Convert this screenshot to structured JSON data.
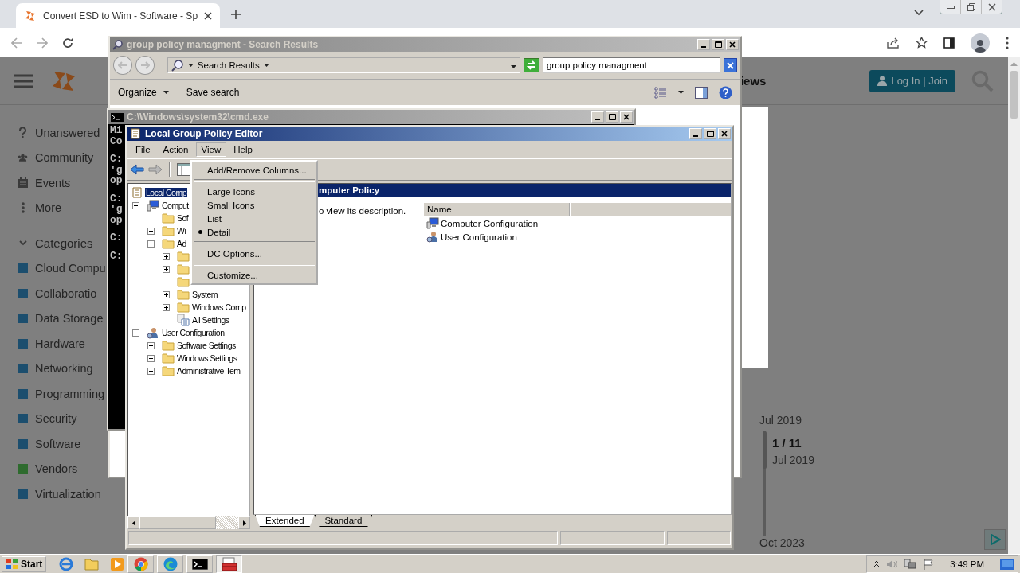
{
  "browser": {
    "tab": {
      "title": "Convert ESD to Wim - Software - Sp",
      "selected": true
    }
  },
  "website": {
    "nav_fragment": "iews",
    "login_button": "Log In | Join",
    "sidebar": [
      {
        "kind": "question",
        "label": "Unanswered"
      },
      {
        "kind": "people",
        "label": "Community"
      },
      {
        "kind": "calendar",
        "label": "Events"
      },
      {
        "kind": "dots",
        "label": "More"
      }
    ],
    "categories_heading": "Categories",
    "categories": [
      {
        "label": "Cloud Compu",
        "color": "#1c4e6e"
      },
      {
        "label": "Collaboratio",
        "color": "#1c4e6e"
      },
      {
        "label": "Data Storage",
        "color": "#1c4e6e"
      },
      {
        "label": "Hardware",
        "color": "#1c4e6e"
      },
      {
        "label": "Networking",
        "color": "#1c4e6e"
      },
      {
        "label": "Programming",
        "color": "#1c4e6e"
      },
      {
        "label": "Security",
        "color": "#1c4e6e"
      },
      {
        "label": "Software",
        "color": "#1c4e6e"
      },
      {
        "label": "Vendors",
        "color": "#2e6b2e"
      },
      {
        "label": "Virtualization",
        "color": "#1c4e6e"
      }
    ],
    "timeline": {
      "start": "Jul 2019",
      "position": "1 / 11",
      "position_date": "Jul 2019",
      "end": "Oct 2023"
    }
  },
  "search_window": {
    "title": "group policy managment - Search Results",
    "active": false,
    "address": "Search Results",
    "search_value": "group policy managment",
    "commands": [
      "Organize",
      "Save search"
    ]
  },
  "cmd_window": {
    "title": "C:\\Windows\\system32\\cmd.exe",
    "active": false,
    "blocks": [
      [
        "Mi",
        "Co"
      ],
      [
        "C:",
        "'g",
        "op"
      ],
      [
        "C:",
        "'g",
        "op"
      ],
      [
        "C:"
      ],
      [
        "C:"
      ]
    ]
  },
  "gpe_window": {
    "title": "Local Group Policy Editor",
    "active": true,
    "menu": [
      {
        "label": "File",
        "selected": false
      },
      {
        "label": "Action",
        "selected": false
      },
      {
        "label": "View",
        "selected": true
      },
      {
        "label": "Help",
        "selected": false
      }
    ],
    "view_menu": [
      {
        "kind": "item",
        "label": "Add/Remove Columns...",
        "checked": false
      },
      {
        "kind": "separator"
      },
      {
        "kind": "item",
        "label": "Large Icons",
        "checked": false
      },
      {
        "kind": "item",
        "label": "Small Icons",
        "checked": false
      },
      {
        "kind": "item",
        "label": "List",
        "checked": false
      },
      {
        "kind": "item",
        "label": "Detail",
        "checked": true
      },
      {
        "kind": "separator"
      },
      {
        "kind": "item",
        "label": "DC Options...",
        "checked": false
      },
      {
        "kind": "separator"
      },
      {
        "kind": "item",
        "label": "Customize...",
        "checked": false
      }
    ],
    "tree": [
      {
        "kind": "policy",
        "label": "Local Comp",
        "selected": true,
        "children": [
          {
            "kind": "computer",
            "label": "Comput",
            "selected": false,
            "expanded": true,
            "children": [
              {
                "kind": "folder",
                "label": "Sof",
                "selected": false
              },
              {
                "kind": "folder",
                "label": "Wi",
                "selected": false,
                "expanded": false
              },
              {
                "kind": "folder",
                "label": "Ad",
                "selected": false,
                "expanded": true,
                "children": [
                  {
                    "kind": "folder",
                    "expanded": false
                  },
                  {
                    "kind": "folder",
                    "expanded": false
                  },
                  {
                    "kind": "folder"
                  },
                  {
                    "kind": "folder",
                    "label": "System",
                    "selected": false,
                    "expanded": false
                  },
                  {
                    "kind": "folder",
                    "label": "Windows Comp",
                    "selected": false,
                    "expanded": false
                  },
                  {
                    "kind": "settings",
                    "label": "All Settings",
                    "selected": false
                  }
                ]
              }
            ]
          },
          {
            "kind": "user",
            "label": "User Configuration",
            "selected": false,
            "expanded": true,
            "children": [
              {
                "kind": "folder",
                "label": "Software Settings",
                "selected": false,
                "expanded": false
              },
              {
                "kind": "folder",
                "label": "Windows Settings",
                "selected": false,
                "expanded": false
              },
              {
                "kind": "folder",
                "label": "Administrative Tem",
                "selected": false,
                "expanded": false
              }
            ]
          }
        ]
      }
    ],
    "details_header": "mputer Policy",
    "details_hint": "o view its description.",
    "columns": [
      "Name"
    ],
    "items": [
      {
        "kind": "computer",
        "label": "Computer Configuration"
      },
      {
        "kind": "user",
        "label": "User Configuration"
      }
    ],
    "view_tabs": [
      {
        "label": "Extended",
        "selected": true
      },
      {
        "label": "Standard",
        "selected": false
      }
    ]
  },
  "taskbar": {
    "start": "Start",
    "tasks": [
      {
        "kind": "chrome",
        "selected": false
      },
      {
        "kind": "edge",
        "selected": false
      },
      {
        "kind": "cmd",
        "selected": false
      },
      {
        "kind": "gpe",
        "selected": true
      }
    ],
    "clock": "3:49 PM"
  }
}
